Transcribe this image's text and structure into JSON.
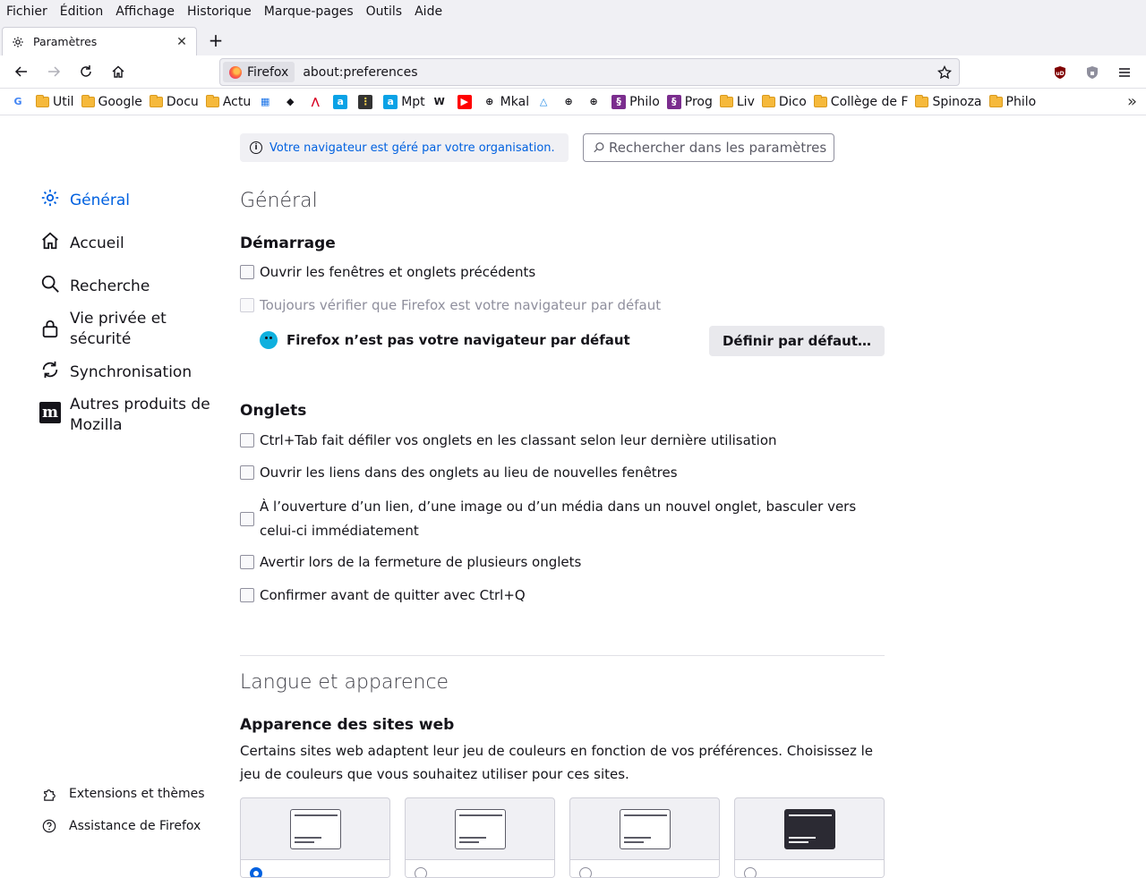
{
  "menubar": [
    "Fichier",
    "Édition",
    "Affichage",
    "Historique",
    "Marque-pages",
    "Outils",
    "Aide"
  ],
  "tab": {
    "title": "Paramètres"
  },
  "urlbar": {
    "identity": "Firefox",
    "url": "about:preferences"
  },
  "bookmarks": [
    {
      "label": "",
      "icon": "google-icon"
    },
    {
      "label": "Util",
      "icon": "folder-icon"
    },
    {
      "label": "Google",
      "icon": "folder-icon"
    },
    {
      "label": "Docu",
      "icon": "folder-icon"
    },
    {
      "label": "Actu",
      "icon": "folder-icon"
    },
    {
      "label": "",
      "icon": "calendar-icon"
    },
    {
      "label": "",
      "icon": "penguin-icon"
    },
    {
      "label": "",
      "icon": "red-logo-icon"
    },
    {
      "label": "",
      "icon": "a-icon"
    },
    {
      "label": "",
      "icon": "traffic-icon"
    },
    {
      "label": "Mpt",
      "icon": "a-icon"
    },
    {
      "label": "",
      "icon": "wikipedia-icon"
    },
    {
      "label": "",
      "icon": "youtube-icon"
    },
    {
      "label": "Mkal",
      "icon": "globe-icon"
    },
    {
      "label": "",
      "icon": "triangle-icon"
    },
    {
      "label": "",
      "icon": "globe-icon"
    },
    {
      "label": "",
      "icon": "globe-icon"
    },
    {
      "label": "Philo",
      "icon": "purple-icon"
    },
    {
      "label": "Prog",
      "icon": "purple-icon"
    },
    {
      "label": "Liv",
      "icon": "folder-icon"
    },
    {
      "label": "Dico",
      "icon": "folder-icon"
    },
    {
      "label": "Collège de F",
      "icon": "folder-icon"
    },
    {
      "label": "Spinoza",
      "icon": "folder-icon"
    },
    {
      "label": "Philo",
      "icon": "folder-icon"
    }
  ],
  "policy_notice": "Votre navigateur est géré par votre organisation.",
  "search": {
    "placeholder": "Rechercher dans les paramètres"
  },
  "sidebar": {
    "categories": [
      {
        "label": "Général",
        "icon": "gear-icon"
      },
      {
        "label": "Accueil",
        "icon": "home-icon"
      },
      {
        "label": "Recherche",
        "icon": "search-icon"
      },
      {
        "label": "Vie privée et sécurité",
        "icon": "lock-icon"
      },
      {
        "label": "Synchronisation",
        "icon": "sync-icon"
      },
      {
        "label": "Autres produits de Mozilla",
        "icon": "mozilla-icon"
      }
    ],
    "footer": [
      {
        "label": "Extensions et thèmes",
        "icon": "puzzle-icon"
      },
      {
        "label": "Assistance de Firefox",
        "icon": "help-icon"
      }
    ]
  },
  "general": {
    "title": "Général",
    "startup": {
      "heading": "Démarrage",
      "restore_session": "Ouvrir les fenêtres et onglets précédents",
      "check_default": "Toujours vérifier que Firefox est votre navigateur par défaut",
      "not_default": "Firefox n’est pas votre navigateur par défaut",
      "set_default_button": "Définir par défaut…"
    },
    "tabs": {
      "heading": "Onglets",
      "ctrl_tab": "Ctrl+Tab fait défiler vos onglets en les classant selon leur dernière utilisation",
      "open_links": "Ouvrir les liens dans des onglets au lieu de nouvelles fenêtres",
      "switch_line1": "À l’ouverture d’un lien, d’une image ou d’un média dans un nouvel onglet, basculer vers",
      "switch_line2": "celui-ci immédiatement",
      "warn_close": "Avertir lors de la fermeture de plusieurs onglets",
      "confirm_quit": "Confirmer avant de quitter avec Ctrl+Q"
    }
  },
  "language": {
    "title": "Langue et apparence",
    "appearance_heading": "Apparence des sites web",
    "appearance_desc_line1": "Certains sites web adaptent leur jeu de couleurs en fonction de vos préférences. Choisissez le",
    "appearance_desc_line2": "jeu de couleurs que vous souhaitez utiliser pour ces sites."
  },
  "colors": {
    "accent": "#0061e0",
    "text": "#15141a",
    "muted": "#8f8f9d"
  }
}
